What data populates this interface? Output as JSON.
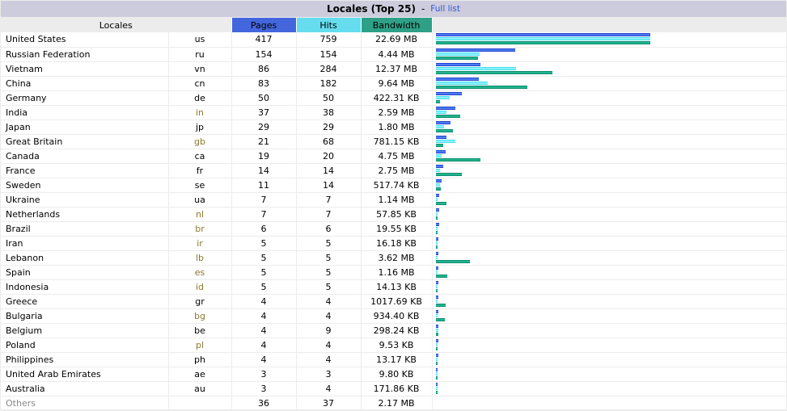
{
  "panel": {
    "title": "Locales (Top 25)",
    "separator": "-",
    "full_list_label": "Full list"
  },
  "table": {
    "headers": {
      "locales": "Locales",
      "pages": "Pages",
      "hits": "Hits",
      "bandwidth": "Bandwidth",
      "bar": ""
    },
    "header_colors": {
      "pages": "#4466DD",
      "hits": "#66DDEE",
      "bandwidth": "#2EA087",
      "locales": "#ECECEC"
    },
    "rows": [
      {
        "name": "United States",
        "code": "us",
        "pages": "417",
        "hits": "759",
        "bandwidth": "22.69 MB",
        "pages_val": 417,
        "hits_val": 759,
        "bw_bytes": 23792189,
        "tint": false
      },
      {
        "name": "Russian Federation",
        "code": "ru",
        "pages": "154",
        "hits": "154",
        "bandwidth": "4.44 MB",
        "pages_val": 154,
        "hits_val": 154,
        "bw_bytes": 4656824,
        "tint": false
      },
      {
        "name": "Vietnam",
        "code": "vn",
        "pages": "86",
        "hits": "284",
        "bandwidth": "12.37 MB",
        "pages_val": 86,
        "hits_val": 284,
        "bw_bytes": 12970885,
        "tint": false
      },
      {
        "name": "China",
        "code": "cn",
        "pages": "83",
        "hits": "182",
        "bandwidth": "9.64 MB",
        "pages_val": 83,
        "hits_val": 182,
        "bw_bytes": 10108764,
        "tint": false
      },
      {
        "name": "Germany",
        "code": "de",
        "pages": "50",
        "hits": "50",
        "bandwidth": "422.31 KB",
        "pages_val": 50,
        "hits_val": 50,
        "bw_bytes": 432445,
        "tint": false
      },
      {
        "name": "India",
        "code": "in",
        "pages": "37",
        "hits": "38",
        "bandwidth": "2.59 MB",
        "pages_val": 37,
        "hits_val": 38,
        "bw_bytes": 2715812,
        "tint": true
      },
      {
        "name": "Japan",
        "code": "jp",
        "pages": "29",
        "hits": "29",
        "bandwidth": "1.80 MB",
        "pages_val": 29,
        "hits_val": 29,
        "bw_bytes": 1887437,
        "tint": false
      },
      {
        "name": "Great Britain",
        "code": "gb",
        "pages": "21",
        "hits": "68",
        "bandwidth": "781.15 KB",
        "pages_val": 21,
        "hits_val": 68,
        "bw_bytes": 799898,
        "tint": true
      },
      {
        "name": "Canada",
        "code": "ca",
        "pages": "19",
        "hits": "20",
        "bandwidth": "4.75 MB",
        "pages_val": 19,
        "hits_val": 20,
        "bw_bytes": 4980736,
        "tint": false
      },
      {
        "name": "France",
        "code": "fr",
        "pages": "14",
        "hits": "14",
        "bandwidth": "2.75 MB",
        "pages_val": 14,
        "hits_val": 14,
        "bw_bytes": 2883584,
        "tint": false
      },
      {
        "name": "Sweden",
        "code": "se",
        "pages": "11",
        "hits": "14",
        "bandwidth": "517.74 KB",
        "pages_val": 11,
        "hits_val": 14,
        "bw_bytes": 530165,
        "tint": false
      },
      {
        "name": "Ukraine",
        "code": "ua",
        "pages": "7",
        "hits": "7",
        "bandwidth": "1.14 MB",
        "pages_val": 7,
        "hits_val": 7,
        "bw_bytes": 1195376,
        "tint": false
      },
      {
        "name": "Netherlands",
        "code": "nl",
        "pages": "7",
        "hits": "7",
        "bandwidth": "57.85 KB",
        "pages_val": 7,
        "hits_val": 7,
        "bw_bytes": 59238,
        "tint": true
      },
      {
        "name": "Brazil",
        "code": "br",
        "pages": "6",
        "hits": "6",
        "bandwidth": "19.55 KB",
        "pages_val": 6,
        "hits_val": 6,
        "bw_bytes": 20019,
        "tint": true
      },
      {
        "name": "Iran",
        "code": "ir",
        "pages": "5",
        "hits": "5",
        "bandwidth": "16.18 KB",
        "pages_val": 5,
        "hits_val": 5,
        "bw_bytes": 16568,
        "tint": true
      },
      {
        "name": "Lebanon",
        "code": "lb",
        "pages": "5",
        "hits": "5",
        "bandwidth": "3.62 MB",
        "pages_val": 5,
        "hits_val": 5,
        "bw_bytes": 3795747,
        "tint": true
      },
      {
        "name": "Spain",
        "code": "es",
        "pages": "5",
        "hits": "5",
        "bandwidth": "1.16 MB",
        "pages_val": 5,
        "hits_val": 5,
        "bw_bytes": 1216348,
        "tint": true
      },
      {
        "name": "Indonesia",
        "code": "id",
        "pages": "5",
        "hits": "5",
        "bandwidth": "14.13 KB",
        "pages_val": 5,
        "hits_val": 5,
        "bw_bytes": 14469,
        "tint": true
      },
      {
        "name": "Greece",
        "code": "gr",
        "pages": "4",
        "hits": "4",
        "bandwidth": "1017.69 KB",
        "pages_val": 4,
        "hits_val": 4,
        "bw_bytes": 1042114,
        "tint": false
      },
      {
        "name": "Bulgaria",
        "code": "bg",
        "pages": "4",
        "hits": "4",
        "bandwidth": "934.40 KB",
        "pages_val": 4,
        "hits_val": 4,
        "bw_bytes": 956826,
        "tint": true
      },
      {
        "name": "Belgium",
        "code": "be",
        "pages": "4",
        "hits": "9",
        "bandwidth": "298.24 KB",
        "pages_val": 4,
        "hits_val": 9,
        "bw_bytes": 305398,
        "tint": false
      },
      {
        "name": "Poland",
        "code": "pl",
        "pages": "4",
        "hits": "4",
        "bandwidth": "9.53 KB",
        "pages_val": 4,
        "hits_val": 4,
        "bw_bytes": 9759,
        "tint": true
      },
      {
        "name": "Philippines",
        "code": "ph",
        "pages": "4",
        "hits": "4",
        "bandwidth": "13.17 KB",
        "pages_val": 4,
        "hits_val": 4,
        "bw_bytes": 13486,
        "tint": false
      },
      {
        "name": "United Arab Emirates",
        "code": "ae",
        "pages": "3",
        "hits": "3",
        "bandwidth": "9.80 KB",
        "pages_val": 3,
        "hits_val": 3,
        "bw_bytes": 10035,
        "tint": false
      },
      {
        "name": "Australia",
        "code": "au",
        "pages": "3",
        "hits": "4",
        "bandwidth": "171.86 KB",
        "pages_val": 3,
        "hits_val": 4,
        "bw_bytes": 175984,
        "tint": false
      },
      {
        "name": "Others",
        "code": "",
        "pages": "36",
        "hits": "37",
        "bandwidth": "2.17 MB",
        "pages_val": 36,
        "hits_val": 37,
        "bw_bytes": 2275737,
        "tint": false,
        "muted": true
      }
    ]
  },
  "chart_data": {
    "type": "bar",
    "title": "Locales (Top 25)",
    "orientation": "horizontal",
    "grouped": true,
    "categories": [
      "United States",
      "Russian Federation",
      "Vietnam",
      "China",
      "Germany",
      "India",
      "Japan",
      "Great Britain",
      "Canada",
      "France",
      "Sweden",
      "Ukraine",
      "Netherlands",
      "Brazil",
      "Iran",
      "Lebanon",
      "Spain",
      "Indonesia",
      "Greece",
      "Bulgaria",
      "Belgium",
      "Poland",
      "Philippines",
      "United Arab Emirates",
      "Australia",
      "Others"
    ],
    "series": [
      {
        "name": "Pages",
        "color": "#4466DD",
        "values": [
          417,
          154,
          86,
          83,
          50,
          37,
          29,
          21,
          19,
          14,
          11,
          7,
          7,
          6,
          5,
          5,
          5,
          5,
          4,
          4,
          4,
          4,
          4,
          3,
          3,
          36
        ]
      },
      {
        "name": "Hits",
        "color": "#66DDEE",
        "values": [
          759,
          154,
          284,
          182,
          50,
          38,
          29,
          68,
          20,
          14,
          14,
          7,
          7,
          6,
          5,
          5,
          5,
          5,
          4,
          4,
          9,
          4,
          4,
          3,
          4,
          37
        ]
      },
      {
        "name": "Bandwidth",
        "color": "#2EA087",
        "unit": "bytes",
        "values": [
          23792189,
          4656824,
          12970885,
          10108764,
          432445,
          2715812,
          1887437,
          799898,
          4980736,
          2883584,
          530165,
          1195376,
          59238,
          20019,
          16568,
          3795747,
          1216348,
          14469,
          1042114,
          956826,
          305398,
          9759,
          13486,
          10035,
          175984,
          2275737
        ]
      }
    ],
    "legend": [
      "Pages",
      "Hits",
      "Bandwidth"
    ],
    "legend_position": "header-row",
    "grid": false
  }
}
